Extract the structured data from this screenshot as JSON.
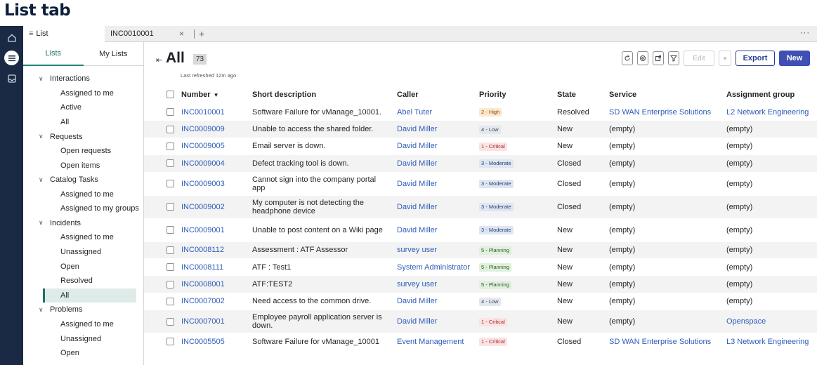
{
  "page_heading": "List tab",
  "tabs": [
    {
      "label": "List"
    },
    {
      "label": "INC0010001"
    }
  ],
  "sidebar": {
    "tabs": [
      "Lists",
      "My Lists"
    ],
    "groups": [
      {
        "label": "Interactions",
        "items": [
          "Assigned to me",
          "Active",
          "All"
        ]
      },
      {
        "label": "Requests",
        "items": [
          "Open requests",
          "Open items"
        ]
      },
      {
        "label": "Catalog Tasks",
        "items": [
          "Assigned to me",
          "Assigned to my groups"
        ]
      },
      {
        "label": "Incidents",
        "items": [
          "Assigned to me",
          "Unassigned",
          "Open",
          "Resolved",
          "All"
        ]
      },
      {
        "label": "Problems",
        "items": [
          "Assigned to me",
          "Unassigned",
          "Open"
        ]
      }
    ],
    "selected": "Incidents/All"
  },
  "list": {
    "title": "All",
    "count": "73",
    "refresh_note": "Last refreshed 12m ago."
  },
  "toolbar": {
    "edit_label": "Edit",
    "export_label": "Export",
    "new_label": "New"
  },
  "columns": [
    "Number",
    "Short description",
    "Caller",
    "Priority",
    "State",
    "Service",
    "Assignment group"
  ],
  "rows": [
    {
      "number": "INC0010001",
      "desc": "Software Failure for vManage_10001.",
      "caller": "Abel Tuter",
      "priority": "2 - High",
      "state": "Resolved",
      "service": "SD WAN Enterprise Solutions",
      "service_link": true,
      "group": "L2 Network Engineering",
      "group_link": true
    },
    {
      "number": "INC0009009",
      "desc": "Unable to access the shared folder.",
      "caller": "David Miller",
      "priority": "4 - Low",
      "state": "New",
      "service": "(empty)",
      "group": "(empty)"
    },
    {
      "number": "INC0009005",
      "desc": "Email server is down.",
      "caller": "David Miller",
      "priority": "1 - Critical",
      "state": "New",
      "service": "(empty)",
      "group": "(empty)"
    },
    {
      "number": "INC0009004",
      "desc": "Defect tracking tool is down.",
      "caller": "David Miller",
      "priority": "3 - Moderate",
      "state": "Closed",
      "service": "(empty)",
      "group": "(empty)"
    },
    {
      "number": "INC0009003",
      "desc": "Cannot sign into the company portal app",
      "caller": "David Miller",
      "priority": "3 - Moderate",
      "state": "Closed",
      "service": "(empty)",
      "group": "(empty)"
    },
    {
      "number": "INC0009002",
      "desc": "My computer is not detecting the headphone device",
      "caller": "David Miller",
      "priority": "3 - Moderate",
      "state": "Closed",
      "service": "(empty)",
      "group": "(empty)"
    },
    {
      "number": "INC0009001",
      "desc": "Unable to post content on a Wiki page",
      "caller": "David Miller",
      "priority": "3 - Moderate",
      "state": "New",
      "service": "(empty)",
      "group": "(empty)"
    },
    {
      "number": "INC0008112",
      "desc": "Assessment : ATF Assessor",
      "caller": "survey user",
      "priority": "5 - Planning",
      "state": "New",
      "service": "(empty)",
      "group": "(empty)"
    },
    {
      "number": "INC0008111",
      "desc": "ATF : Test1",
      "caller": "System Administrator",
      "priority": "5 - Planning",
      "state": "New",
      "service": "(empty)",
      "group": "(empty)"
    },
    {
      "number": "INC0008001",
      "desc": "ATF:TEST2",
      "caller": "survey user",
      "priority": "5 - Planning",
      "state": "New",
      "service": "(empty)",
      "group": "(empty)"
    },
    {
      "number": "INC0007002",
      "desc": "Need access to the common drive.",
      "caller": "David Miller",
      "priority": "4 - Low",
      "state": "New",
      "service": "(empty)",
      "group": "(empty)"
    },
    {
      "number": "INC0007001",
      "desc": "Employee payroll application server is down.",
      "caller": "David Miller",
      "priority": "1 - Critical",
      "state": "New",
      "service": "(empty)",
      "group": "Openspace",
      "group_link": true
    },
    {
      "number": "INC0005505",
      "desc": "Software Failure for vManage_10001",
      "caller": "Event Management",
      "priority": "1 - Critical",
      "state": "Closed",
      "service": "SD WAN Enterprise Solutions",
      "service_link": true,
      "group": "L3 Network Engineering",
      "group_link": true
    }
  ],
  "colors": {
    "rail": "#1b2a44",
    "link": "#2e5cb8",
    "accent": "#1f6f64",
    "primary_button": "#3f4fb3",
    "priority": {
      "1 - Critical": {
        "bg": "#fbe3e3",
        "fg": "#a52a2a"
      },
      "2 - High": {
        "bg": "#fde8cf",
        "fg": "#8a4b08"
      },
      "3 - Moderate": {
        "bg": "#dde6f3",
        "fg": "#2b3e6a"
      },
      "4 - Low": {
        "bg": "#e4e8ee",
        "fg": "#33415c"
      },
      "5 - Planning": {
        "bg": "#e0f0dc",
        "fg": "#2d5b24"
      }
    }
  }
}
